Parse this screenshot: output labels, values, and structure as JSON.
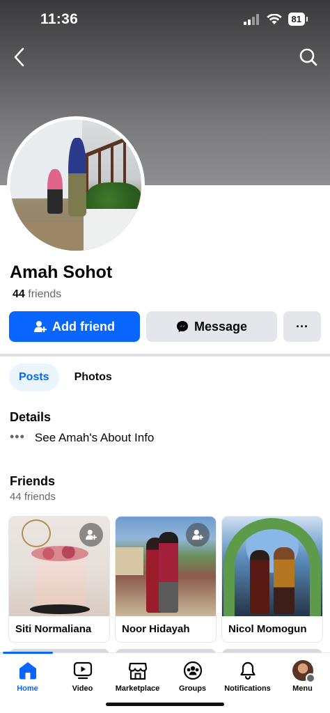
{
  "status_bar": {
    "time": "11:36",
    "battery": "81"
  },
  "profile": {
    "name": "Amah Sohot",
    "friends_number": "44",
    "friends_word": "friends"
  },
  "actions": {
    "add_friend": "Add friend",
    "message": "Message",
    "more": "···"
  },
  "tabs": [
    {
      "label": "Posts",
      "active": true
    },
    {
      "label": "Photos",
      "active": false
    }
  ],
  "details": {
    "heading": "Details",
    "about_dots": "•••",
    "about_link": "See Amah's About Info"
  },
  "friends_section": {
    "heading": "Friends",
    "count_label": "44 friends",
    "cards": [
      {
        "name": "Siti Normaliana"
      },
      {
        "name": "Noor Hidayah"
      },
      {
        "name": "Nicol Momogun"
      }
    ]
  },
  "bottom_nav": {
    "items": [
      {
        "label": "Home",
        "icon": "home-icon",
        "active": true
      },
      {
        "label": "Video",
        "icon": "video-icon",
        "active": false
      },
      {
        "label": "Marketplace",
        "icon": "marketplace-icon",
        "active": false
      },
      {
        "label": "Groups",
        "icon": "groups-icon",
        "active": false
      },
      {
        "label": "Notifications",
        "icon": "bell-icon",
        "active": false
      },
      {
        "label": "Menu",
        "icon": "profile-avatar",
        "active": false
      }
    ]
  },
  "colors": {
    "accent": "#0866ff",
    "button_gray": "#e4e6eb",
    "secondary_text": "#65676b"
  }
}
